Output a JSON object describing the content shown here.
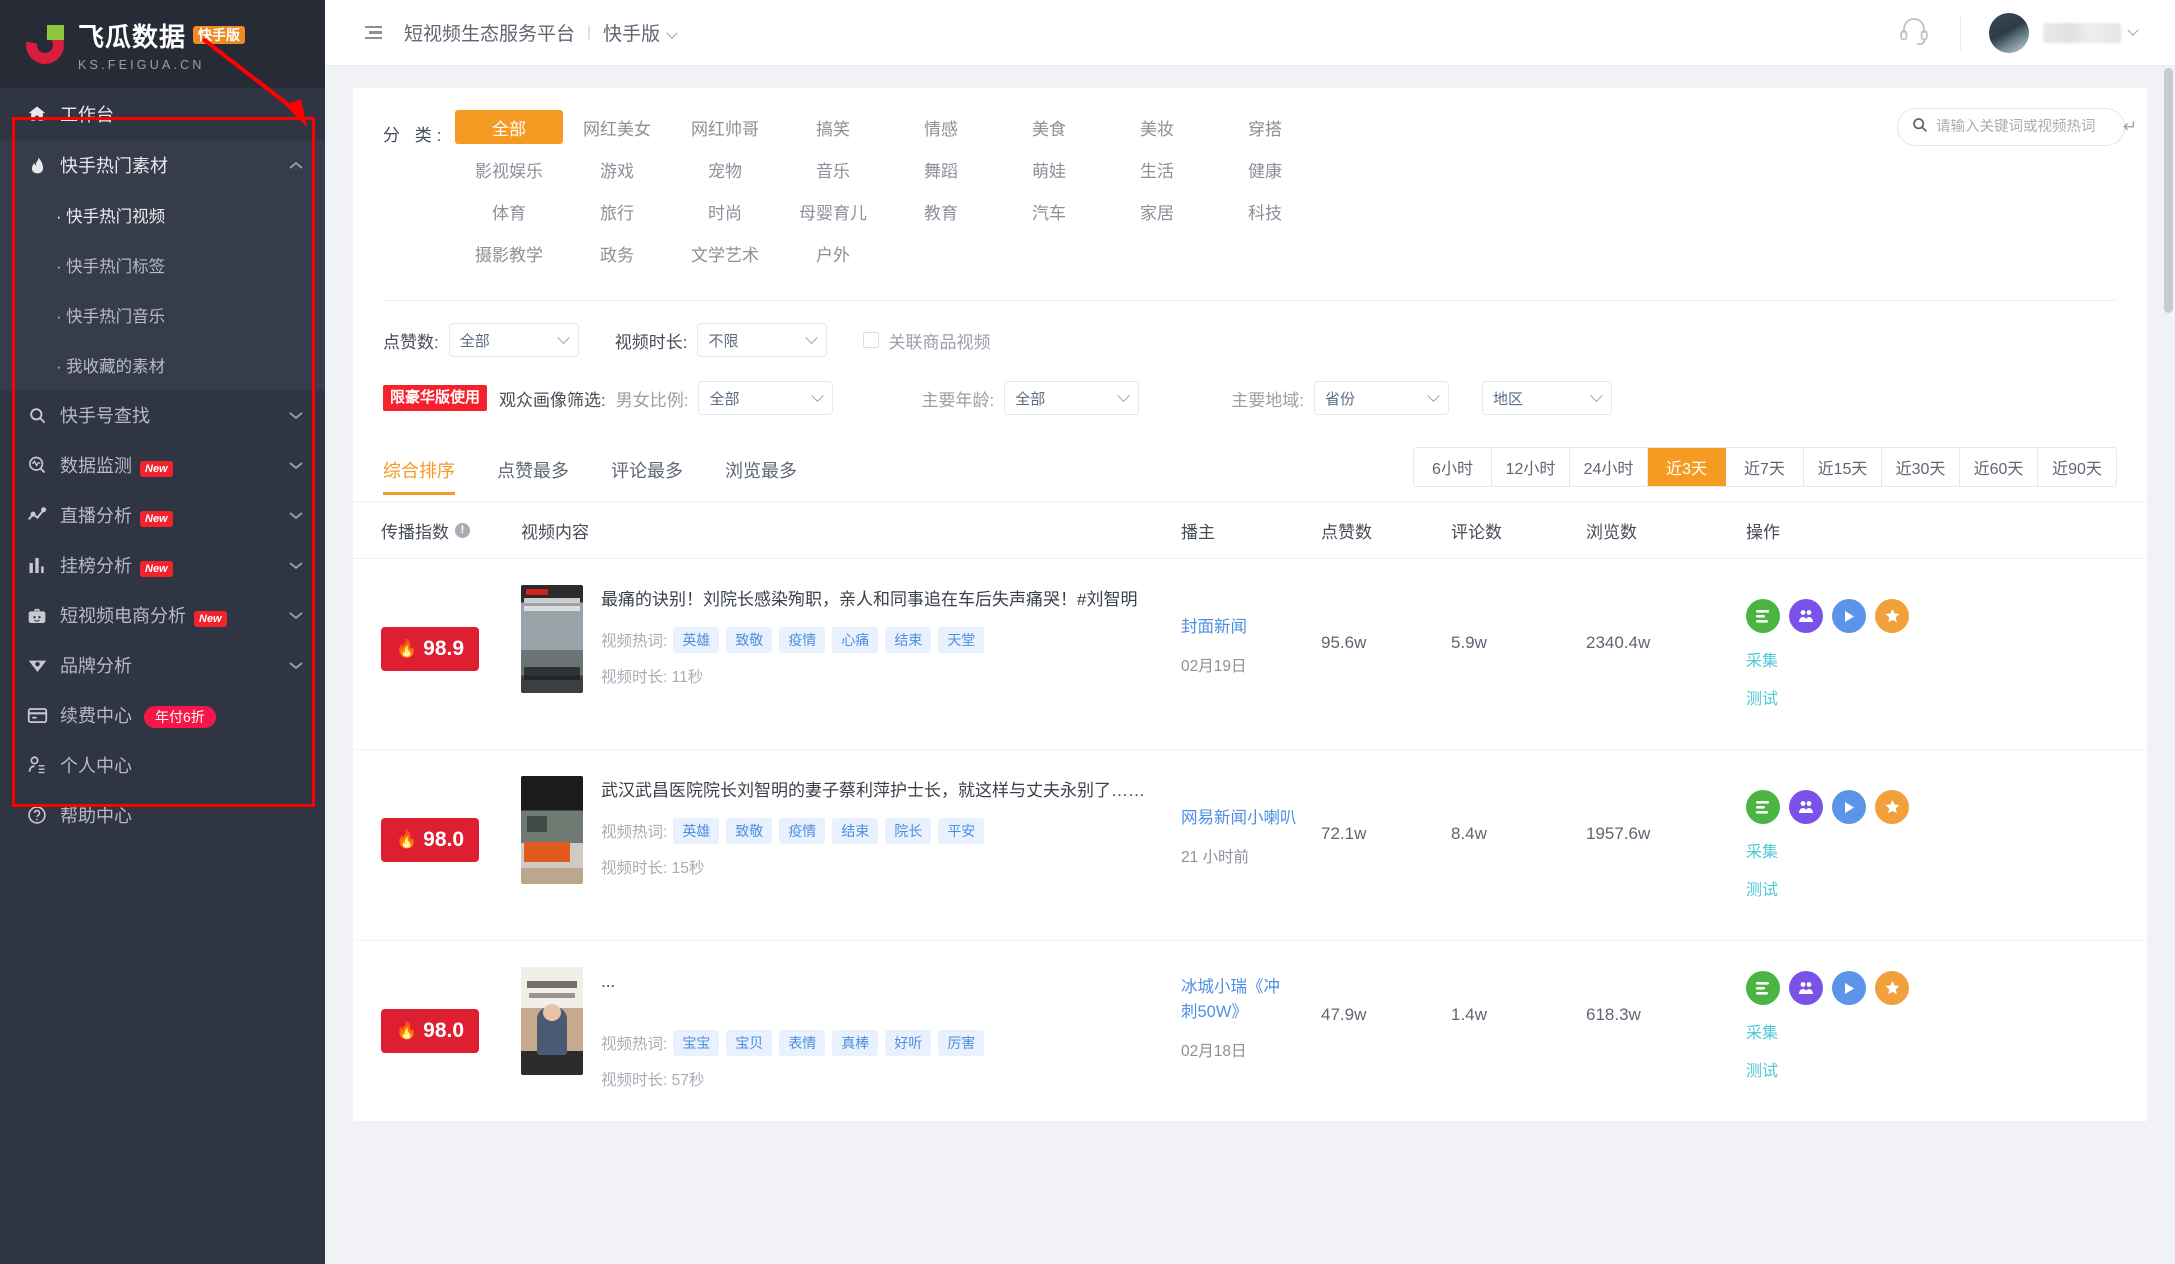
{
  "brand": {
    "name": "飞瓜数据",
    "version_tag": "快手版",
    "domain": "KS.FEIGUA.CN"
  },
  "sidebar": {
    "home": {
      "label": "工作台",
      "icon": "home-icon"
    },
    "group": {
      "label": "快手热门素材",
      "icon": "fire-icon",
      "expanded": true,
      "children": [
        {
          "label": "· 快手热门视频",
          "selected": true
        },
        {
          "label": "· 快手热门标签",
          "selected": false
        },
        {
          "label": "· 快手热门音乐",
          "selected": false
        },
        {
          "label": "· 我收藏的素材",
          "selected": false
        }
      ]
    },
    "items": [
      {
        "label": "快手号查找",
        "icon": "search-icon",
        "badge": ""
      },
      {
        "label": "数据监测",
        "icon": "monitor-icon",
        "badge": "New"
      },
      {
        "label": "直播分析",
        "icon": "line-chart-icon",
        "badge": "New"
      },
      {
        "label": "挂榜分析",
        "icon": "bar-chart-icon",
        "badge": "New"
      },
      {
        "label": "短视频电商分析",
        "icon": "briefcase-icon",
        "badge": "New"
      },
      {
        "label": "品牌分析",
        "icon": "diamond-icon",
        "badge": ""
      }
    ],
    "footer_items": [
      {
        "label": "续费中心",
        "icon": "card-icon",
        "pill": "年付6折"
      },
      {
        "label": "个人中心",
        "icon": "user-icon",
        "pill": ""
      },
      {
        "label": "帮助中心",
        "icon": "question-icon",
        "pill": ""
      }
    ]
  },
  "topbar": {
    "menu_icon": "hamburger-icon",
    "title": "短视频生态服务平台",
    "separator": "|",
    "version": "快手版",
    "support_icon": "headset-icon",
    "username": ""
  },
  "filters": {
    "category_label": "分 类:",
    "categories": [
      "全部",
      "网红美女",
      "网红帅哥",
      "搞笑",
      "情感",
      "美食",
      "美妆",
      "穿搭",
      "影视娱乐",
      "游戏",
      "宠物",
      "音乐",
      "舞蹈",
      "萌娃",
      "生活",
      "健康",
      "体育",
      "旅行",
      "时尚",
      "母婴育儿",
      "教育",
      "汽车",
      "家居",
      "科技",
      "摄影教学",
      "政务",
      "文学艺术",
      "户外"
    ],
    "selected_category": "全部",
    "search": {
      "placeholder": "请输入关键词或视频热词",
      "value": "",
      "icon": "search-icon",
      "enter_icon": "enter-icon"
    },
    "likes_label": "点赞数:",
    "likes_value": "全部",
    "duration_label": "视频时长:",
    "duration_value": "不限",
    "product_checkbox_label": "关联商品视频",
    "product_checked": false,
    "luxury_tag": "限豪华版使用",
    "audience_label": "观众画像筛选:",
    "gender_label": "男女比例:",
    "gender_value": "全部",
    "age_label": "主要年龄:",
    "age_value": "全部",
    "region_label": "主要地域:",
    "province_value": "省份",
    "area_value": "地区"
  },
  "sort": {
    "tabs": [
      "综合排序",
      "点赞最多",
      "评论最多",
      "浏览最多"
    ],
    "selected_tab": "综合排序",
    "time_ranges": [
      "6小时",
      "12小时",
      "24小时",
      "近3天",
      "近7天",
      "近15天",
      "近30天",
      "近60天",
      "近90天"
    ],
    "selected_range": "近3天"
  },
  "table": {
    "headers": {
      "index": "传播指数",
      "content": "视频内容",
      "author": "播主",
      "likes": "点赞数",
      "comments": "评论数",
      "views": "浏览数",
      "ops": "操作"
    },
    "keyword_label": "视频热词:",
    "duration_label_prefix": "视频时长:",
    "op_links": [
      "采集",
      "测试"
    ],
    "op_icons": [
      "list-icon",
      "group-icon",
      "play-icon",
      "star-icon"
    ],
    "rows": [
      {
        "score": "98.9",
        "title": "最痛的诀别！刘院长感染殉职，亲人和同事追在车后失声痛哭！#刘智明",
        "keywords": [
          "英雄",
          "致敬",
          "疫情",
          "心痛",
          "结束",
          "天堂"
        ],
        "duration": "11秒",
        "author": "封面新闻",
        "date": "02月19日",
        "likes": "95.6w",
        "comments": "5.9w",
        "views": "2340.4w"
      },
      {
        "score": "98.0",
        "title": "武汉武昌医院院长刘智明的妻子蔡利萍护士长，就这样与丈夫永别了……",
        "keywords": [
          "英雄",
          "致敬",
          "疫情",
          "结束",
          "院长",
          "平安"
        ],
        "duration": "15秒",
        "author": "网易新闻小喇叭",
        "date": "21 小时前",
        "likes": "72.1w",
        "comments": "8.4w",
        "views": "1957.6w"
      },
      {
        "score": "98.0",
        "title": "...",
        "keywords": [
          "宝宝",
          "宝贝",
          "表情",
          "真棒",
          "好听",
          "厉害"
        ],
        "duration": "57秒",
        "author": "冰城小瑞《冲刺50W》",
        "date": "02月18日",
        "likes": "47.9w",
        "comments": "1.4w",
        "views": "618.3w"
      }
    ]
  },
  "colors": {
    "accent_orange": "#f59a23",
    "brand_red": "#d81e3c",
    "badge_red": "#f5222d",
    "link_blue": "#4d8fe0",
    "sidebar_bg": "#2f3543",
    "annotation_red": "#ff0000"
  }
}
